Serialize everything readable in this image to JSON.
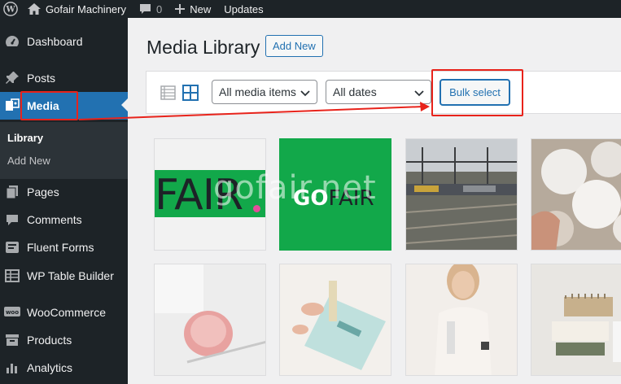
{
  "admin_bar": {
    "site_name": "Gofair Machinery",
    "comments_count": "0",
    "new_label": "New",
    "updates_label": "Updates"
  },
  "sidebar": {
    "items": [
      {
        "label": "Dashboard",
        "icon": "dashboard-icon"
      },
      {
        "label": "Posts",
        "icon": "pin-icon"
      },
      {
        "label": "Media",
        "icon": "media-icon",
        "current": true
      },
      {
        "label": "Pages",
        "icon": "pages-icon"
      },
      {
        "label": "Comments",
        "icon": "comment-icon"
      },
      {
        "label": "Fluent Forms",
        "icon": "forms-icon"
      },
      {
        "label": "WP Table Builder",
        "icon": "table-icon"
      },
      {
        "label": "WooCommerce",
        "icon": "woo-icon"
      },
      {
        "label": "Products",
        "icon": "archive-icon"
      },
      {
        "label": "Analytics",
        "icon": "chart-icon"
      }
    ],
    "submenu": [
      {
        "label": "Library",
        "active": true
      },
      {
        "label": "Add New"
      }
    ]
  },
  "main": {
    "title": "Media Library",
    "add_new_label": "Add New",
    "filter_type": "All media items",
    "filter_date": "All dates",
    "bulk_select_label": "Bulk select"
  },
  "grid": {
    "thumb1_text": "FAIR",
    "thumb2_text_go": "GO",
    "thumb2_text_fair": "FAIR",
    "watermark": "gofair.net"
  },
  "colors": {
    "accent": "#2271b1",
    "sidebar_bg": "#1d2327",
    "annotation_red": "#e8231b",
    "brand_green": "#12a84a"
  }
}
